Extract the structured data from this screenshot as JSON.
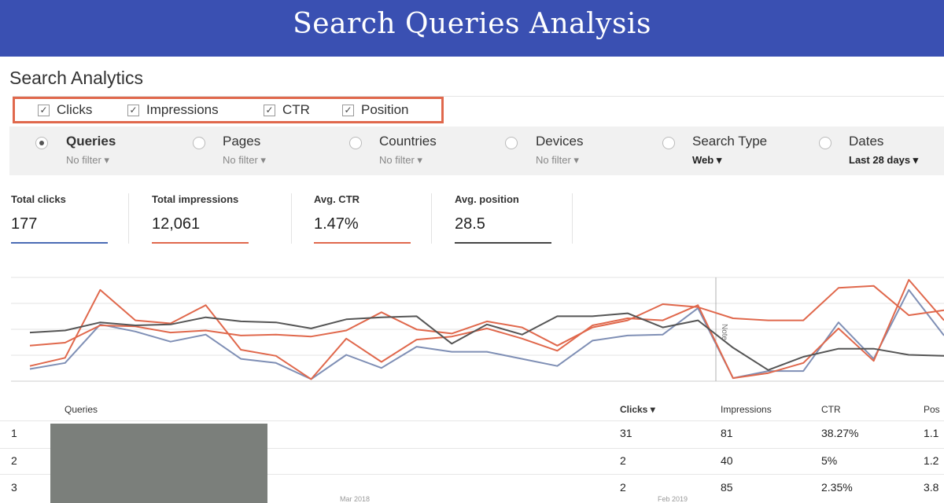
{
  "banner": {
    "title": "Search Queries Analysis"
  },
  "app_title": "Search Analytics",
  "metrics": [
    {
      "label": "Clicks",
      "checked": true
    },
    {
      "label": "Impressions",
      "checked": true
    },
    {
      "label": "CTR",
      "checked": true
    },
    {
      "label": "Position",
      "checked": true
    }
  ],
  "filters": [
    {
      "label": "Queries",
      "sub": "No filter",
      "selected": true
    },
    {
      "label": "Pages",
      "sub": "No filter",
      "selected": false
    },
    {
      "label": "Countries",
      "sub": "No filter",
      "selected": false
    },
    {
      "label": "Devices",
      "sub": "No filter",
      "selected": false
    },
    {
      "label": "Search Type",
      "sub": "Web",
      "selected": false
    },
    {
      "label": "Dates",
      "sub": "Last 28 days",
      "selected": false
    }
  ],
  "stats": [
    {
      "label": "Total clicks",
      "value": "177",
      "color": "#4a6bb5"
    },
    {
      "label": "Total impressions",
      "value": "12,061",
      "color": "#e0684c"
    },
    {
      "label": "Avg. CTR",
      "value": "1.47%",
      "color": "#e0684c"
    },
    {
      "label": "Avg. position",
      "value": "28.5",
      "color": "#444444"
    }
  ],
  "chart_data": {
    "type": "line",
    "note_label": "Note",
    "series": [
      {
        "color": "#7f8fb5",
        "values": [
          12,
          18,
          56,
          49,
          39,
          46,
          22,
          18,
          2,
          26,
          13,
          34,
          29,
          29,
          22,
          15,
          40,
          45,
          46,
          72,
          3,
          10,
          10,
          58,
          22,
          90,
          45
        ]
      },
      {
        "color": "#e0684c",
        "values": [
          15,
          23,
          90,
          60,
          57,
          75,
          31,
          25,
          2,
          42,
          19,
          41,
          44,
          52,
          42,
          30,
          55,
          62,
          60,
          75,
          3,
          8,
          18,
          52,
          20,
          100,
          60
        ]
      },
      {
        "color": "#e0684c",
        "values": [
          35,
          38,
          55,
          54,
          48,
          50,
          45,
          46,
          44,
          50,
          68,
          51,
          47,
          59,
          53,
          35,
          53,
          60,
          76,
          73,
          62,
          60,
          60,
          92,
          94,
          65,
          70
        ]
      },
      {
        "color": "#555555",
        "values": [
          48,
          50,
          58,
          55,
          56,
          63,
          59,
          58,
          52,
          61,
          63,
          64,
          37,
          56,
          46,
          64,
          64,
          67,
          53,
          60,
          33,
          11,
          24,
          32,
          32,
          26,
          25
        ]
      }
    ],
    "x_ticks": [
      "Mar 2018",
      "Feb 2019"
    ]
  },
  "table": {
    "headers": {
      "query": "Queries",
      "clicks": "Clicks ▾",
      "impressions": "Impressions",
      "ctr": "CTR",
      "position": "Pos"
    },
    "rows": [
      {
        "num": "1",
        "clicks": "31",
        "impressions": "81",
        "ctr": "38.27%",
        "position": "1.1"
      },
      {
        "num": "2",
        "clicks": "2",
        "impressions": "40",
        "ctr": "5%",
        "position": "1.2"
      },
      {
        "num": "3",
        "clicks": "2",
        "impressions": "85",
        "ctr": "2.35%",
        "position": "3.8"
      }
    ]
  }
}
